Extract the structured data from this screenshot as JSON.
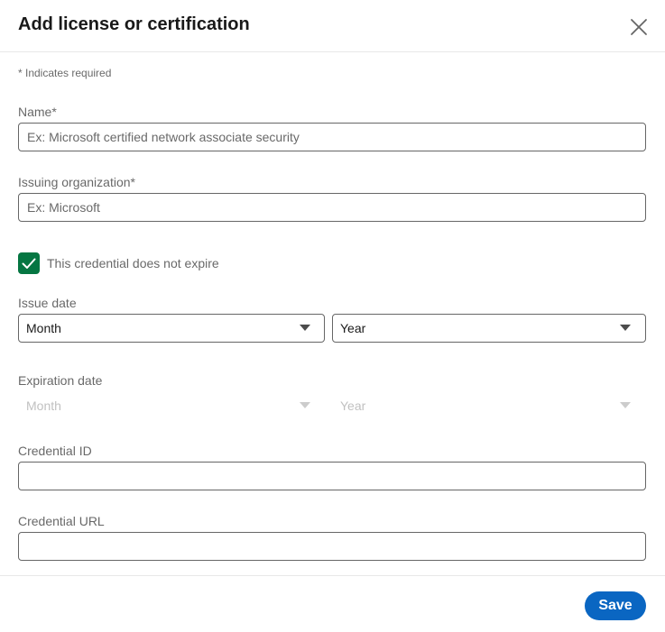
{
  "dialog": {
    "title": "Add license or certification",
    "close_icon": "close-icon"
  },
  "form": {
    "required_note": "* Indicates required",
    "name": {
      "label": "Name*",
      "value": "",
      "placeholder": "Ex: Microsoft certified network associate security"
    },
    "organization": {
      "label": "Issuing organization*",
      "value": "",
      "placeholder": "Ex: Microsoft"
    },
    "no_expire": {
      "label": "This credential does not expire",
      "checked": true
    },
    "issue_date": {
      "label": "Issue date",
      "month": "Month",
      "year": "Year"
    },
    "expiration_date": {
      "label": "Expiration date",
      "month": "Month",
      "year": "Year",
      "disabled": true
    },
    "credential_id": {
      "label": "Credential ID",
      "value": ""
    },
    "credential_url": {
      "label": "Credential URL",
      "value": ""
    }
  },
  "footer": {
    "save_label": "Save"
  },
  "colors": {
    "primary": "#0a66c2",
    "checkbox": "#057642",
    "border": "#666666",
    "divider": "#e8e8e8"
  }
}
